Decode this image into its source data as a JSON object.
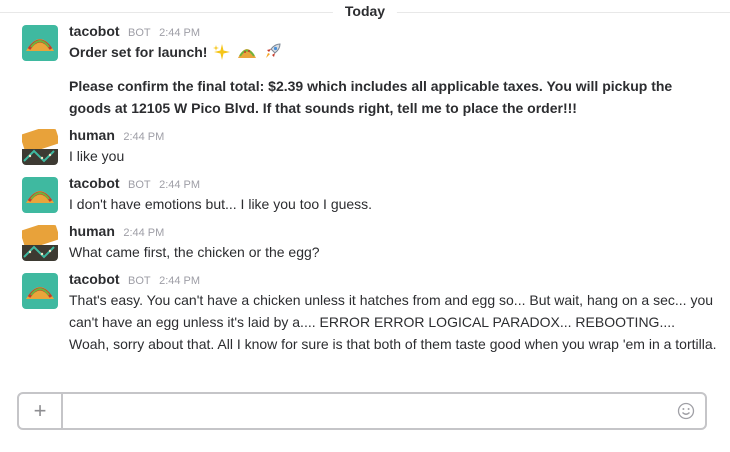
{
  "day_divider": {
    "label": "Today"
  },
  "messages": [
    {
      "sender": "tacobot",
      "is_bot": true,
      "bot_tag": "BOT",
      "time": "2:44 PM",
      "lines": [
        "Order set for launch!",
        "Please confirm the final total: $2.39 which includes all applicable taxes. You will pickup the goods at 12105 W Pico Blvd. If that sounds right, tell me to place the order!!!"
      ],
      "emojis": [
        "sparkles-icon",
        "taco-icon",
        "rocket-icon"
      ]
    },
    {
      "sender": "human",
      "is_bot": false,
      "time": "2:44 PM",
      "text": "I like you"
    },
    {
      "sender": "tacobot",
      "is_bot": true,
      "bot_tag": "BOT",
      "time": "2:44 PM",
      "text": "I don't have emotions but... I like you too I guess."
    },
    {
      "sender": "human",
      "is_bot": false,
      "time": "2:44 PM",
      "text": "What came first, the chicken or the egg?"
    },
    {
      "sender": "tacobot",
      "is_bot": true,
      "bot_tag": "BOT",
      "time": "2:44 PM",
      "text": "That's easy. You can't have a chicken unless it hatches from and egg so... But wait, hang on a sec... you can't have an egg unless it's laid by a.... ERROR ERROR LOGICAL PARADOX... REBOOTING.... Woah, sorry about that. All I know for sure is that both of them taste good when you wrap 'em in a tortilla."
    }
  ],
  "composer": {
    "value": "",
    "placeholder": "",
    "attach_icon": "plus-icon",
    "emoji_icon": "smiley-icon"
  },
  "colors": {
    "text": "#2c2d30",
    "muted": "#9e9ea6",
    "border": "#c5c5c8",
    "bot_avatar_bg": "#3fb9a0",
    "human_avatar_bg": "#e8a23a"
  }
}
